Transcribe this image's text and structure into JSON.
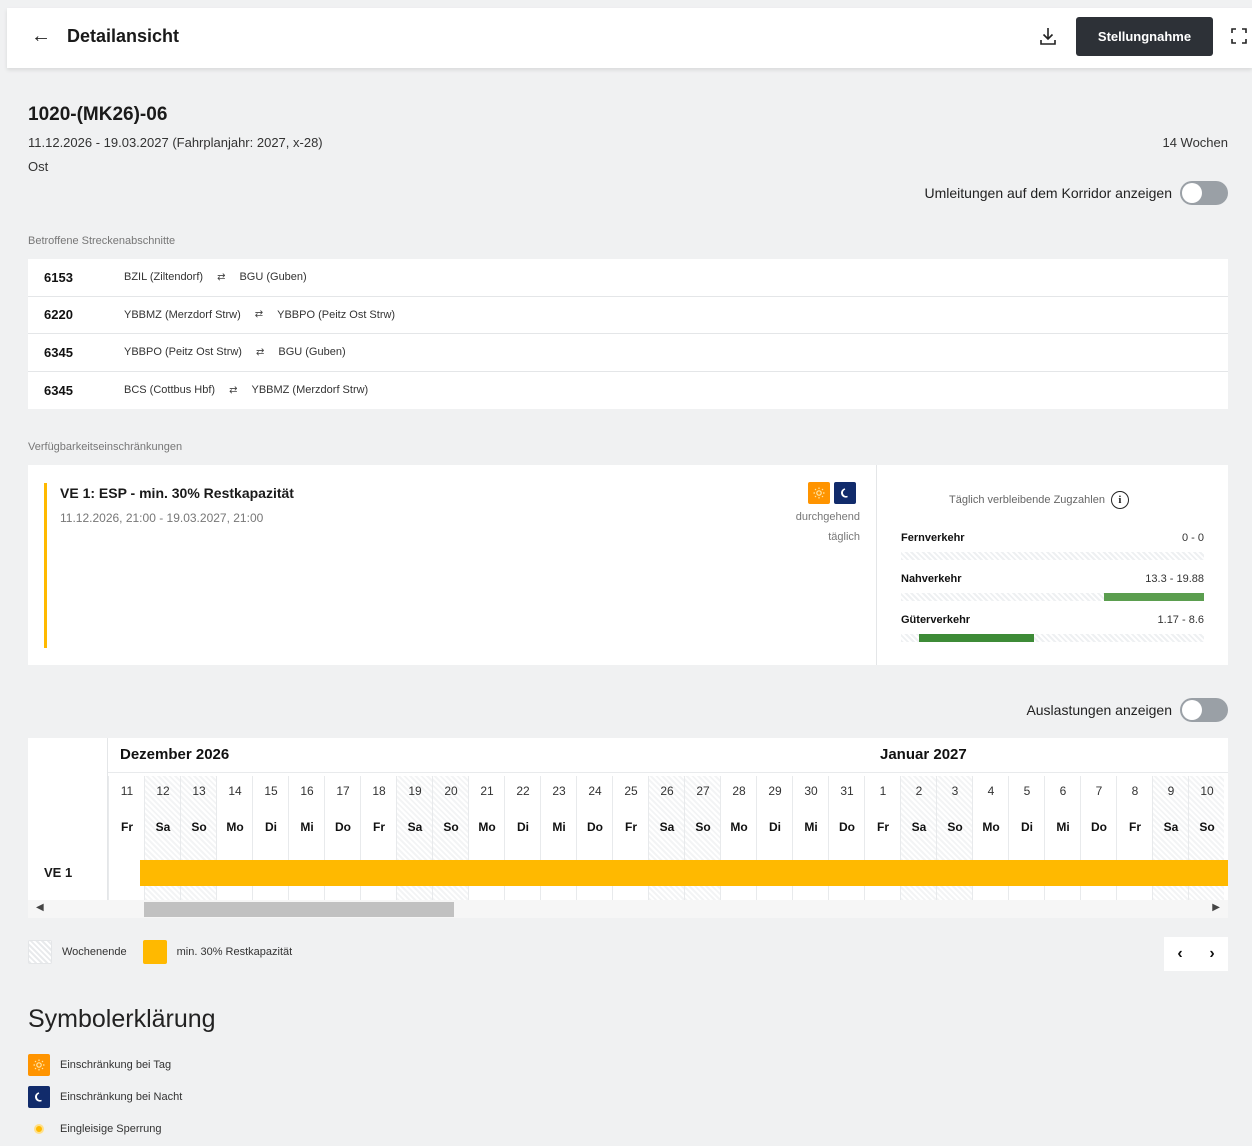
{
  "header": {
    "title": "Detailansicht",
    "action_label": "Stellungnahme"
  },
  "project": {
    "id": "1020-(MK26)-06",
    "period": "11.12.2026 - 19.03.2027 (Fahrplanjahr: 2027, x-28)",
    "region": "Ost",
    "weeks": "14 Wochen"
  },
  "toggles": {
    "corridor": "Umleitungen auf dem Korridor anzeigen",
    "utilization": "Auslastungen anzeigen"
  },
  "segments": {
    "label": "Betroffene Streckenabschnitte",
    "rows": [
      {
        "id": "6153",
        "from": "BZIL (Ziltendorf)",
        "to": "BGU (Guben)"
      },
      {
        "id": "6220",
        "from": "YBBMZ (Merzdorf Strw)",
        "to": "YBBPO (Peitz Ost Strw)"
      },
      {
        "id": "6345",
        "from": "YBBPO (Peitz Ost Strw)",
        "to": "BGU (Guben)"
      },
      {
        "id": "6345",
        "from": "BCS (Cottbus Hbf)",
        "to": "YBBMZ (Merzdorf Strw)"
      }
    ]
  },
  "restrictions": {
    "label": "Verfügbarkeitseinschränkungen",
    "item": {
      "title": "VE 1: ESP - min. 30% Restkapazität",
      "time": "11.12.2026, 21:00 - 19.03.2027, 21:00",
      "mode": "durchgehend",
      "frequency": "täglich",
      "accent_color": "#ffb900"
    },
    "counts": {
      "heading": "Täglich verbleibende Zugzahlen",
      "rows": [
        {
          "label": "Fernverkehr",
          "value": "0 - 0",
          "fill_start": 0.0,
          "fill_end": 0.0,
          "color": "#5b9e4f"
        },
        {
          "label": "Nahverkehr",
          "value": "13.3 - 19.88",
          "fill_start": 0.67,
          "fill_end": 1.0,
          "color": "#5b9e4f"
        },
        {
          "label": "Güterverkehr",
          "value": "1.17 - 8.6",
          "fill_start": 0.06,
          "fill_end": 0.44,
          "color": "#3d8b37"
        }
      ]
    }
  },
  "timeline": {
    "months": [
      "Dezember 2026",
      "Januar 2027"
    ],
    "row_label": "VE 1",
    "days": [
      {
        "n": "11",
        "d": "Fr",
        "w": false
      },
      {
        "n": "12",
        "d": "Sa",
        "w": true
      },
      {
        "n": "13",
        "d": "So",
        "w": true
      },
      {
        "n": "14",
        "d": "Mo",
        "w": false
      },
      {
        "n": "15",
        "d": "Di",
        "w": false
      },
      {
        "n": "16",
        "d": "Mi",
        "w": false
      },
      {
        "n": "17",
        "d": "Do",
        "w": false
      },
      {
        "n": "18",
        "d": "Fr",
        "w": false
      },
      {
        "n": "19",
        "d": "Sa",
        "w": true
      },
      {
        "n": "20",
        "d": "So",
        "w": true
      },
      {
        "n": "21",
        "d": "Mo",
        "w": false
      },
      {
        "n": "22",
        "d": "Di",
        "w": false
      },
      {
        "n": "23",
        "d": "Mi",
        "w": false
      },
      {
        "n": "24",
        "d": "Do",
        "w": false
      },
      {
        "n": "25",
        "d": "Fr",
        "w": false
      },
      {
        "n": "26",
        "d": "Sa",
        "w": true
      },
      {
        "n": "27",
        "d": "So",
        "w": true
      },
      {
        "n": "28",
        "d": "Mo",
        "w": false
      },
      {
        "n": "29",
        "d": "Di",
        "w": false
      },
      {
        "n": "30",
        "d": "Mi",
        "w": false
      },
      {
        "n": "31",
        "d": "Do",
        "w": false
      },
      {
        "n": "1",
        "d": "Fr",
        "w": false
      },
      {
        "n": "2",
        "d": "Sa",
        "w": true
      },
      {
        "n": "3",
        "d": "So",
        "w": true
      },
      {
        "n": "4",
        "d": "Mo",
        "w": false
      },
      {
        "n": "5",
        "d": "Di",
        "w": false
      },
      {
        "n": "6",
        "d": "Mi",
        "w": false
      },
      {
        "n": "7",
        "d": "Do",
        "w": false
      },
      {
        "n": "8",
        "d": "Fr",
        "w": false
      },
      {
        "n": "9",
        "d": "Sa",
        "w": true
      },
      {
        "n": "10",
        "d": "So",
        "w": true
      }
    ]
  },
  "legend": {
    "weekend": "Wochenende",
    "restriction": "min. 30% Restkapazität"
  },
  "symbols": {
    "title": "Symbolerklärung",
    "items": [
      {
        "label": "Einschränkung bei Tag",
        "icon": "sun-icon"
      },
      {
        "label": "Einschränkung bei Nacht",
        "icon": "moon-icon"
      },
      {
        "label": "Eingleisige Sperrung",
        "icon": "single-track-dot-icon"
      }
    ]
  }
}
